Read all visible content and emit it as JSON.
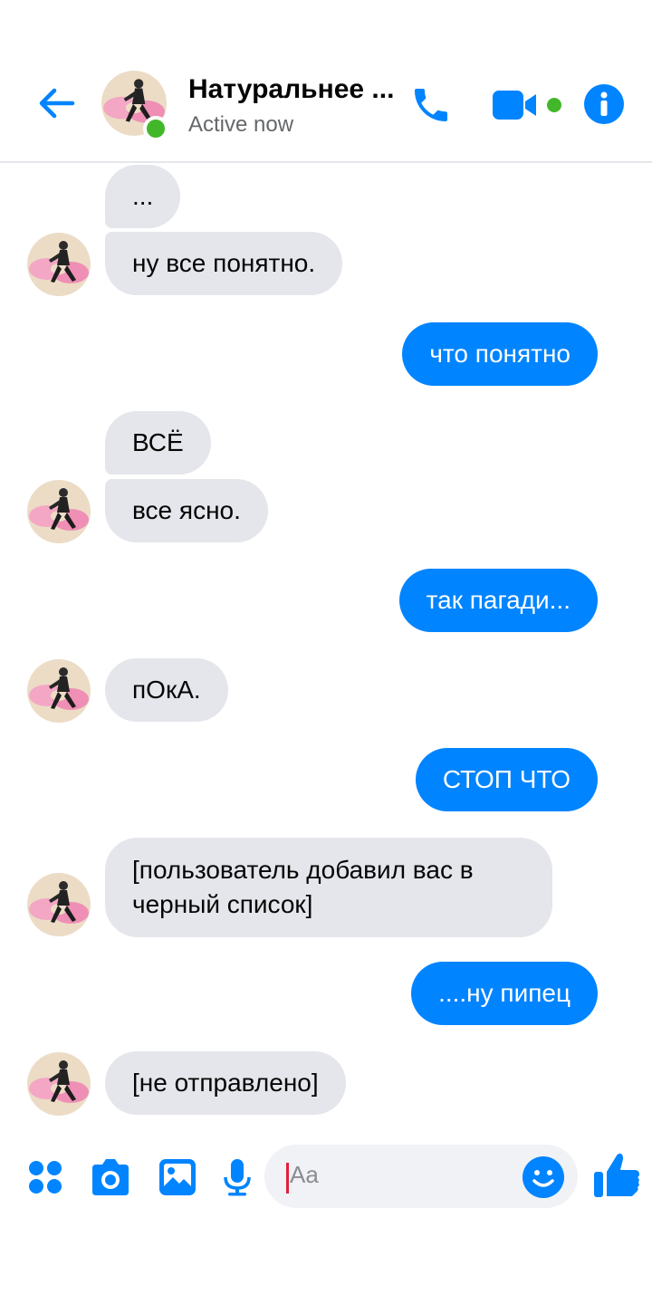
{
  "header": {
    "title": "Натуральнее ...",
    "status": "Active now"
  },
  "messages": [
    {
      "from": "them",
      "text": "..."
    },
    {
      "from": "them",
      "text": "ну все понятно."
    },
    {
      "from": "me",
      "text": "что понятно"
    },
    {
      "from": "them",
      "text": "ВСЁ"
    },
    {
      "from": "them",
      "text": "все ясно."
    },
    {
      "from": "me",
      "text": "так пагади..."
    },
    {
      "from": "them",
      "text": "пОкА."
    },
    {
      "from": "me",
      "text": "СТОП ЧТО"
    },
    {
      "from": "them",
      "text": "[пользователь добавил вас в черный список]"
    },
    {
      "from": "me",
      "text": "....ну пипец"
    },
    {
      "from": "them",
      "text": "[не отправлено]"
    }
  ],
  "composer": {
    "placeholder": "Aa"
  },
  "colors": {
    "accent": "#0084ff",
    "incoming_bubble": "#e4e6eb",
    "online": "#42b72a"
  },
  "icons": [
    "back-arrow-icon",
    "phone-icon",
    "video-camera-icon",
    "info-icon",
    "apps-icon",
    "camera-icon",
    "gallery-icon",
    "microphone-icon",
    "smiley-icon",
    "thumbs-up-icon"
  ]
}
